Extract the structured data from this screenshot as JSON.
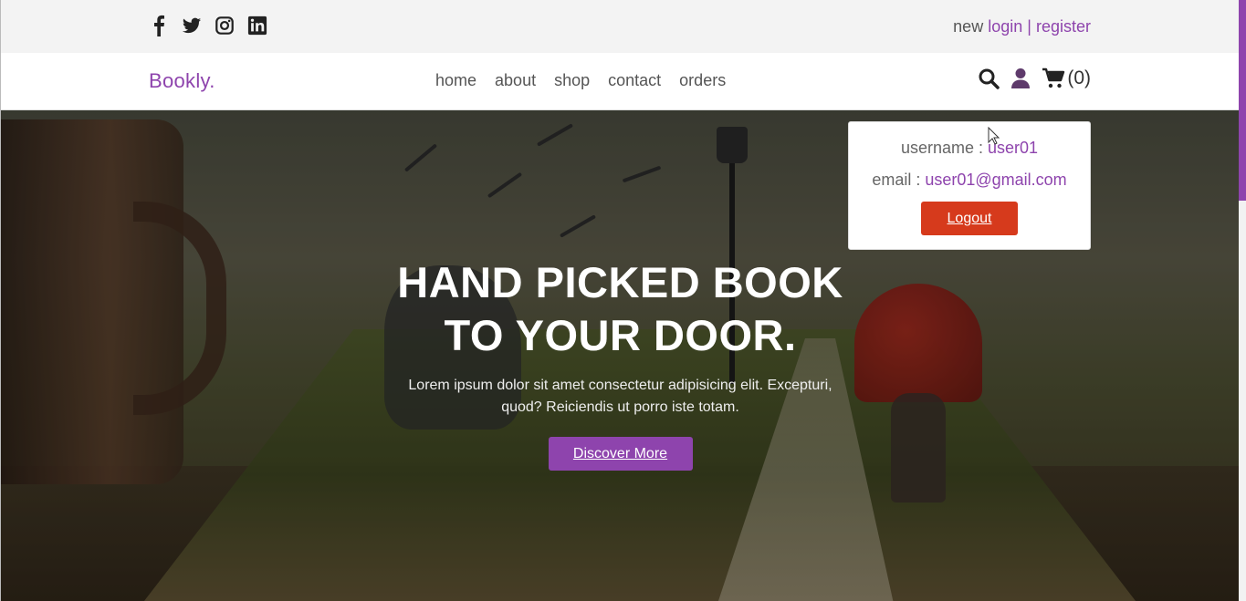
{
  "header": {
    "social": [
      {
        "name": "facebook-icon"
      },
      {
        "name": "twitter-icon"
      },
      {
        "name": "instagram-icon"
      },
      {
        "name": "linkedin-icon"
      }
    ],
    "auth": {
      "prefix": "new",
      "login": "login",
      "separator": "|",
      "register": "register"
    }
  },
  "nav": {
    "logo": "Bookly.",
    "links": [
      "home",
      "about",
      "shop",
      "contact",
      "orders"
    ],
    "cart_count": "(0)",
    "icons": [
      "search-icon",
      "user-icon",
      "cart-icon"
    ]
  },
  "user_box": {
    "username_label": "username :",
    "username": "user01",
    "email_label": "email :",
    "email": "user01@gmail.com",
    "logout": "Logout"
  },
  "hero": {
    "title_line1": "HAND PICKED BOOK",
    "title_line2": "TO YOUR DOOR.",
    "text": "Lorem ipsum dolor sit amet consectetur adipisicing elit. Excepturi, quod? Reiciendis ut porro iste totam.",
    "button": "Discover More"
  },
  "colors": {
    "accent": "#8e44ad",
    "danger": "#d63a1c",
    "topbar": "#f3f3f3"
  }
}
